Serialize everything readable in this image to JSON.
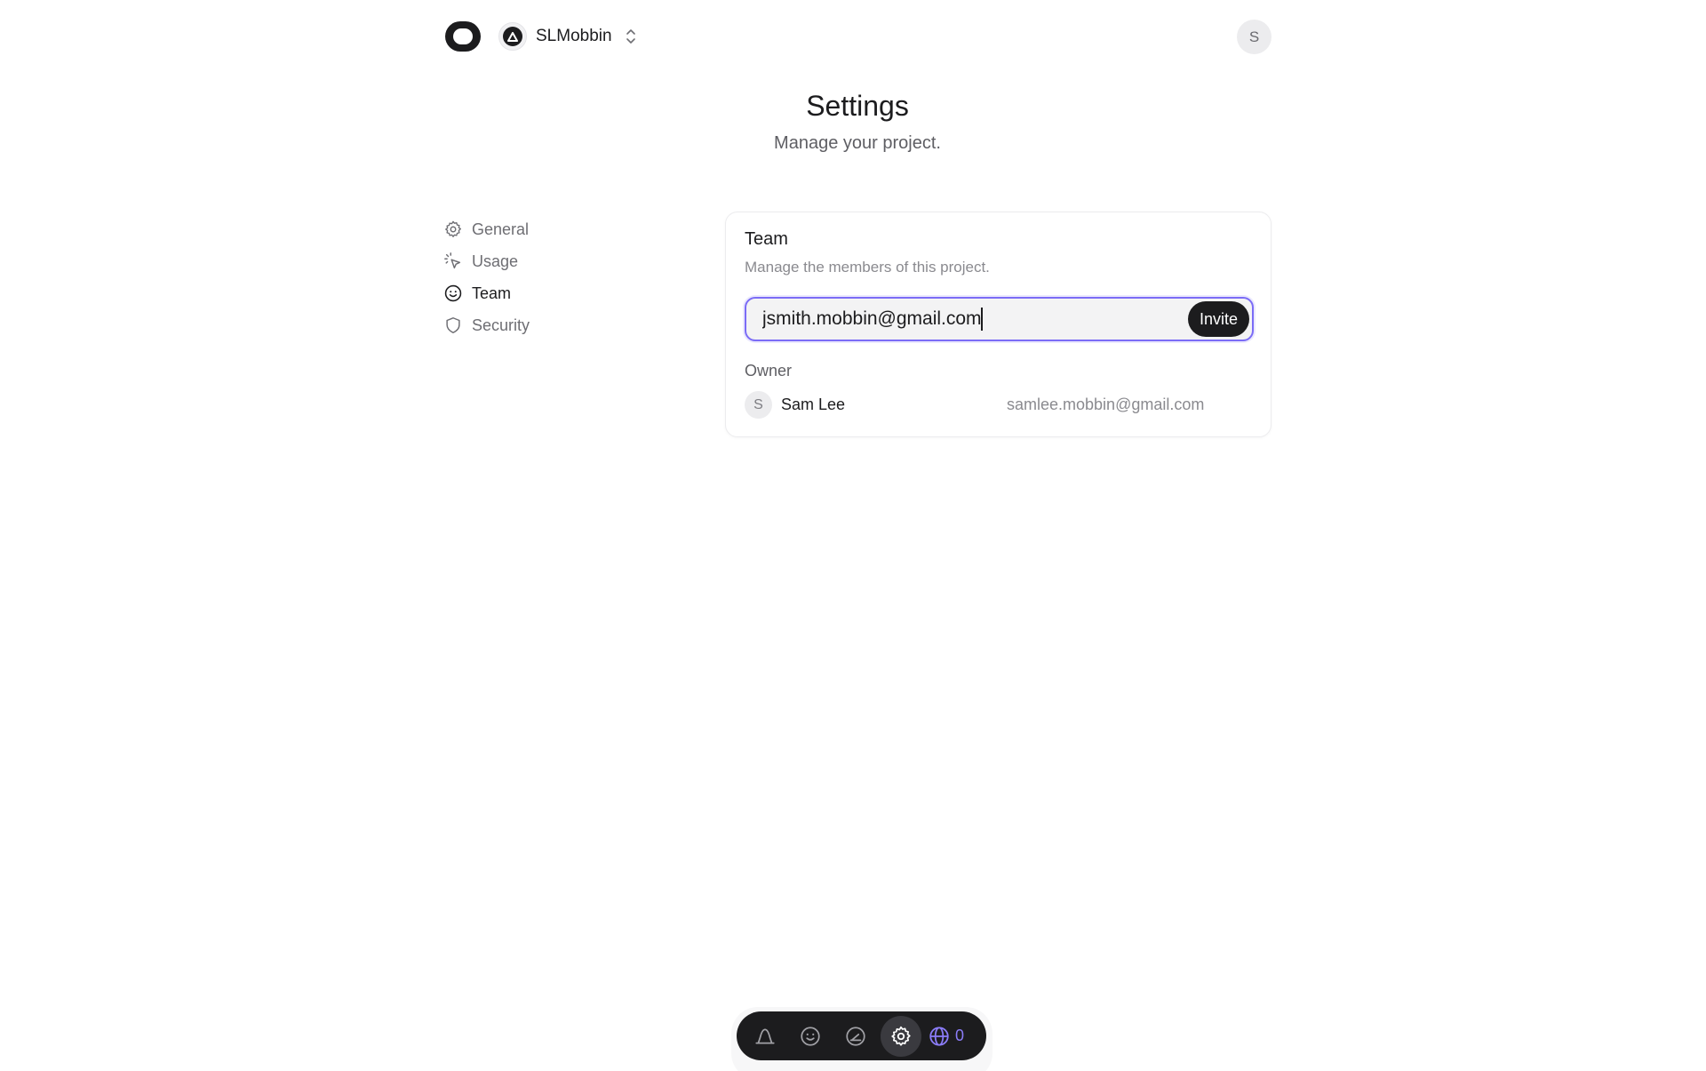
{
  "header": {
    "project_name": "SLMobbin",
    "user_initial": "S"
  },
  "page": {
    "title": "Settings",
    "subtitle": "Manage your project."
  },
  "sidebar": {
    "items": [
      {
        "label": "General",
        "icon": "gear-icon",
        "active": false
      },
      {
        "label": "Usage",
        "icon": "cursor-click-icon",
        "active": false
      },
      {
        "label": "Team",
        "icon": "smile-icon",
        "active": true
      },
      {
        "label": "Security",
        "icon": "shield-icon",
        "active": false
      }
    ]
  },
  "team_card": {
    "title": "Team",
    "description": "Manage the members of this project.",
    "invite_value": "jsmith.mobbin@gmail.com",
    "invite_button": "Invite",
    "owner_label": "Owner",
    "owner": {
      "initial": "S",
      "name": "Sam Lee",
      "email": "samlee.mobbin@gmail.com"
    }
  },
  "dock": {
    "items": [
      "bell-icon",
      "smile-icon",
      "gauge-icon",
      "gear-icon",
      "globe-icon"
    ],
    "active": "gear-icon",
    "globe_count": "0",
    "accent_color": "#8b7cf8"
  },
  "colors": {
    "focus_ring": "#7b6cf6",
    "dark": "#1c1c1e"
  }
}
